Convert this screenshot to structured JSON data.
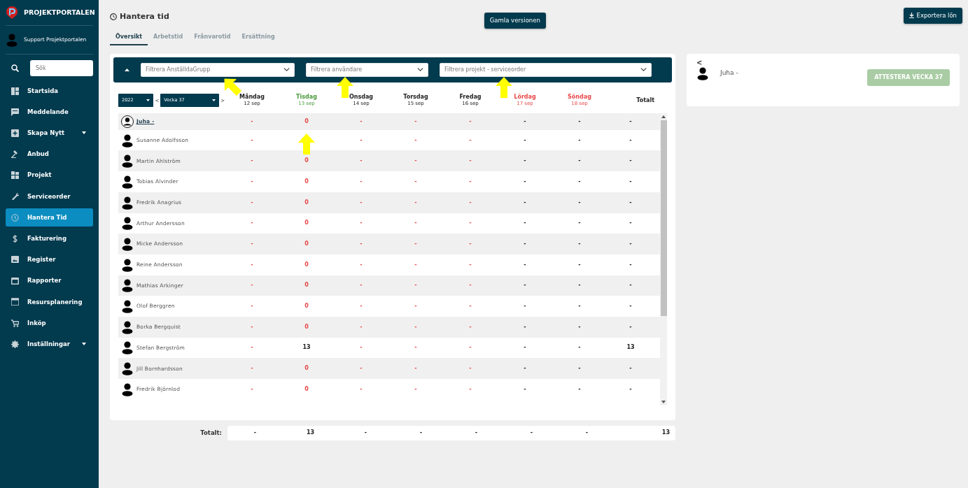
{
  "brand": {
    "name": "PROJEKTPORTALEN"
  },
  "user": {
    "name": "Support Projektportalen"
  },
  "sidebar": {
    "search": {
      "placeholder": "Sök"
    },
    "items": [
      {
        "label": "Startsida",
        "selected": false,
        "submenu": false
      },
      {
        "label": "Meddelande",
        "selected": false,
        "submenu": false
      },
      {
        "label": "Skapa Nytt",
        "selected": false,
        "submenu": true
      },
      {
        "label": "Anbud",
        "selected": false,
        "submenu": false
      },
      {
        "label": "Projekt",
        "selected": false,
        "submenu": false
      },
      {
        "label": "Serviceorder",
        "selected": false,
        "submenu": false
      },
      {
        "label": "Hantera Tid",
        "selected": true,
        "submenu": false
      },
      {
        "label": "Fakturering",
        "selected": false,
        "submenu": false
      },
      {
        "label": "Register",
        "selected": false,
        "submenu": false
      },
      {
        "label": "Rapporter",
        "selected": false,
        "submenu": false
      },
      {
        "label": "Resursplanering",
        "selected": false,
        "submenu": false
      },
      {
        "label": "Inköp",
        "selected": false,
        "submenu": false
      },
      {
        "label": "Inställningar",
        "selected": false,
        "submenu": true
      }
    ]
  },
  "page": {
    "title": "Hantera tid",
    "old_version_button": "Gamla versionen",
    "export_button": "Exportera lön"
  },
  "tabs": [
    {
      "label": "Översikt",
      "selected": true
    },
    {
      "label": "Arbetstid",
      "selected": false
    },
    {
      "label": "Frånvarotid",
      "selected": false
    },
    {
      "label": "Ersättning",
      "selected": false
    }
  ],
  "filters": [
    {
      "placeholder": "Filtrera AnställdaGrupp",
      "pointer_arrow": true,
      "arrow_tilted": true
    },
    {
      "placeholder": "Filtrera användare",
      "pointer_arrow": true,
      "arrow_tilted": false
    },
    {
      "placeholder": "Filtrera projekt - serviceorder",
      "pointer_arrow": true,
      "arrow_tilted": false
    }
  ],
  "period": {
    "year": "2022",
    "week": "Vecka 37",
    "prev": "<",
    "next": ">"
  },
  "days": [
    {
      "name": "Måndag",
      "date": "12 sep",
      "kind": "weekday"
    },
    {
      "name": "Tisdag",
      "date": "13 sep",
      "kind": "today"
    },
    {
      "name": "Onsdag",
      "date": "14 sep",
      "kind": "weekday"
    },
    {
      "name": "Torsdag",
      "date": "15 sep",
      "kind": "weekday"
    },
    {
      "name": "Fredag",
      "date": "16 sep",
      "kind": "weekday"
    },
    {
      "name": "Lördag",
      "date": "17 sep",
      "kind": "weekend"
    },
    {
      "name": "Söndag",
      "date": "18 sep",
      "kind": "weekend"
    },
    {
      "name": "Totalt",
      "kind": "total"
    }
  ],
  "rows": [
    {
      "name": "Juha -",
      "selected": true,
      "cells": [
        {
          "text": "-",
          "warn": true
        },
        {
          "text": "0",
          "warn": true
        },
        {
          "text": "-",
          "warn": true
        },
        {
          "text": "-",
          "warn": true
        },
        {
          "text": "-",
          "warn": true
        },
        {
          "text": "-",
          "warn": false
        },
        {
          "text": "-",
          "warn": false
        },
        {
          "text": "-",
          "warn": false
        }
      ]
    },
    {
      "name": "Susanne Adolfsson",
      "selected": false,
      "cells": [
        {
          "text": "-",
          "warn": true
        },
        {
          "pointer_arrow": true
        },
        {
          "text": "-",
          "warn": true
        },
        {
          "text": "-",
          "warn": true
        },
        {
          "text": "-",
          "warn": true
        },
        {
          "text": "-",
          "warn": false
        },
        {
          "text": "-",
          "warn": false
        },
        {
          "text": "-",
          "warn": false
        }
      ]
    },
    {
      "name": "Martin Ahlström",
      "selected": false,
      "cells": [
        {
          "text": "-",
          "warn": true
        },
        {
          "text": "0",
          "warn": true
        },
        {
          "text": "-",
          "warn": true
        },
        {
          "text": "-",
          "warn": true
        },
        {
          "text": "-",
          "warn": true
        },
        {
          "text": "-",
          "warn": false
        },
        {
          "text": "-",
          "warn": false
        },
        {
          "text": "-",
          "warn": false
        }
      ]
    },
    {
      "name": "Tobias Alvinder",
      "selected": false,
      "cells": [
        {
          "text": "-",
          "warn": true
        },
        {
          "text": "0",
          "warn": true
        },
        {
          "text": "-",
          "warn": true
        },
        {
          "text": "-",
          "warn": true
        },
        {
          "text": "-",
          "warn": true
        },
        {
          "text": "-",
          "warn": false
        },
        {
          "text": "-",
          "warn": false
        },
        {
          "text": "-",
          "warn": false
        }
      ]
    },
    {
      "name": "Fredrik Anagrius",
      "selected": false,
      "cells": [
        {
          "text": "-",
          "warn": true
        },
        {
          "text": "0",
          "warn": true
        },
        {
          "text": "-",
          "warn": true
        },
        {
          "text": "-",
          "warn": true
        },
        {
          "text": "-",
          "warn": true
        },
        {
          "text": "-",
          "warn": false
        },
        {
          "text": "-",
          "warn": false
        },
        {
          "text": "-",
          "warn": false
        }
      ]
    },
    {
      "name": "Arthur Andersson",
      "selected": false,
      "cells": [
        {
          "text": "-",
          "warn": true
        },
        {
          "text": "0",
          "warn": true
        },
        {
          "text": "-",
          "warn": true
        },
        {
          "text": "-",
          "warn": true
        },
        {
          "text": "-",
          "warn": true
        },
        {
          "text": "-",
          "warn": false
        },
        {
          "text": "-",
          "warn": false
        },
        {
          "text": "-",
          "warn": false
        }
      ]
    },
    {
      "name": "Micke Andersson",
      "selected": false,
      "cells": [
        {
          "text": "-",
          "warn": true
        },
        {
          "text": "0",
          "warn": true
        },
        {
          "text": "-",
          "warn": true
        },
        {
          "text": "-",
          "warn": true
        },
        {
          "text": "-",
          "warn": true
        },
        {
          "text": "-",
          "warn": false
        },
        {
          "text": "-",
          "warn": false
        },
        {
          "text": "-",
          "warn": false
        }
      ]
    },
    {
      "name": "Reine Andersson",
      "selected": false,
      "cells": [
        {
          "text": "-",
          "warn": true
        },
        {
          "text": "0",
          "warn": true
        },
        {
          "text": "-",
          "warn": true
        },
        {
          "text": "-",
          "warn": true
        },
        {
          "text": "-",
          "warn": true
        },
        {
          "text": "-",
          "warn": false
        },
        {
          "text": "-",
          "warn": false
        },
        {
          "text": "-",
          "warn": false
        }
      ]
    },
    {
      "name": "Mathias Arkinger",
      "selected": false,
      "cells": [
        {
          "text": "-",
          "warn": true
        },
        {
          "text": "0",
          "warn": true
        },
        {
          "text": "-",
          "warn": true
        },
        {
          "text": "-",
          "warn": true
        },
        {
          "text": "-",
          "warn": true
        },
        {
          "text": "-",
          "warn": false
        },
        {
          "text": "-",
          "warn": false
        },
        {
          "text": "-",
          "warn": false
        }
      ]
    },
    {
      "name": "Olof Berggren",
      "selected": false,
      "cells": [
        {
          "text": "-",
          "warn": true
        },
        {
          "text": "0",
          "warn": true
        },
        {
          "text": "-",
          "warn": true
        },
        {
          "text": "-",
          "warn": true
        },
        {
          "text": "-",
          "warn": true
        },
        {
          "text": "-",
          "warn": false
        },
        {
          "text": "-",
          "warn": false
        },
        {
          "text": "-",
          "warn": false
        }
      ]
    },
    {
      "name": "Borka Bergquist",
      "selected": false,
      "cells": [
        {
          "text": "-",
          "warn": true
        },
        {
          "text": "0",
          "warn": true
        },
        {
          "text": "-",
          "warn": true
        },
        {
          "text": "-",
          "warn": true
        },
        {
          "text": "-",
          "warn": true
        },
        {
          "text": "-",
          "warn": false
        },
        {
          "text": "-",
          "warn": false
        },
        {
          "text": "-",
          "warn": false
        }
      ]
    },
    {
      "name": "Stefan Bergström",
      "selected": false,
      "cells": [
        {
          "text": "-",
          "warn": true
        },
        {
          "text": "13",
          "warn": false
        },
        {
          "text": "-",
          "warn": true
        },
        {
          "text": "-",
          "warn": true
        },
        {
          "text": "-",
          "warn": true
        },
        {
          "text": "-",
          "warn": false
        },
        {
          "text": "-",
          "warn": false
        },
        {
          "text": "13",
          "warn": false
        }
      ]
    },
    {
      "name": "Jill Bornhardsson",
      "selected": false,
      "cells": [
        {
          "text": "-",
          "warn": true
        },
        {
          "text": "0",
          "warn": true
        },
        {
          "text": "-",
          "warn": true
        },
        {
          "text": "-",
          "warn": true
        },
        {
          "text": "-",
          "warn": true
        },
        {
          "text": "-",
          "warn": false
        },
        {
          "text": "-",
          "warn": false
        },
        {
          "text": "-",
          "warn": false
        }
      ]
    },
    {
      "name": "Fredrik Björnlod",
      "selected": false,
      "cells": [
        {
          "text": "-",
          "warn": true
        },
        {
          "text": "0",
          "warn": true
        },
        {
          "text": "-",
          "warn": true
        },
        {
          "text": "-",
          "warn": true
        },
        {
          "text": "-",
          "warn": true
        },
        {
          "text": "-",
          "warn": false
        },
        {
          "text": "-",
          "warn": false
        },
        {
          "text": "-",
          "warn": false
        }
      ]
    }
  ],
  "totals": {
    "label": "Totalt:",
    "cells": [
      "-",
      "13",
      "-",
      "-",
      "-",
      "-",
      "-",
      "13"
    ]
  },
  "detail": {
    "back": "<",
    "name": "Juha -",
    "attest_button": "ATTESTERA VECKA 37",
    "disabled": true
  }
}
